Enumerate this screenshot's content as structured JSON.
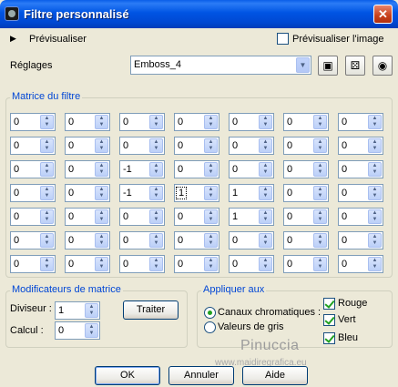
{
  "window": {
    "title": "Filtre personnalisé",
    "close_symbol": "✕"
  },
  "preview": {
    "label": "Prévisualiser",
    "image_label": "Prévisualiser l'image",
    "image_checked": false
  },
  "settings": {
    "label": "Réglages",
    "preset": "Emboss_4"
  },
  "matrix": {
    "title": "Matrice du filtre",
    "rows": [
      [
        "0",
        "0",
        "0",
        "0",
        "0",
        "0",
        "0"
      ],
      [
        "0",
        "0",
        "0",
        "0",
        "0",
        "0",
        "0"
      ],
      [
        "0",
        "0",
        "-1",
        "0",
        "0",
        "0",
        "0"
      ],
      [
        "0",
        "0",
        "-1",
        "1",
        "1",
        "0",
        "0"
      ],
      [
        "0",
        "0",
        "0",
        "0",
        "1",
        "0",
        "0"
      ],
      [
        "0",
        "0",
        "0",
        "0",
        "0",
        "0",
        "0"
      ],
      [
        "0",
        "0",
        "0",
        "0",
        "0",
        "0",
        "0"
      ]
    ]
  },
  "modifiers": {
    "title": "Modificateurs de matrice",
    "divisor_label": "Diviseur :",
    "divisor": "1",
    "bias_label": "Calcul :",
    "bias": "0",
    "process_button": "Traiter"
  },
  "apply": {
    "title": "Appliquer aux",
    "channels_label": "Canaux chromatiques :",
    "gray_label": "Valeurs de gris",
    "red_label": "Rouge",
    "green_label": "Vert",
    "blue_label": "Bleu"
  },
  "buttons": {
    "ok": "OK",
    "cancel": "Annuler",
    "help": "Aide"
  },
  "watermark": {
    "name": "Pinuccia",
    "url": "www.maidiregrafica.eu"
  }
}
